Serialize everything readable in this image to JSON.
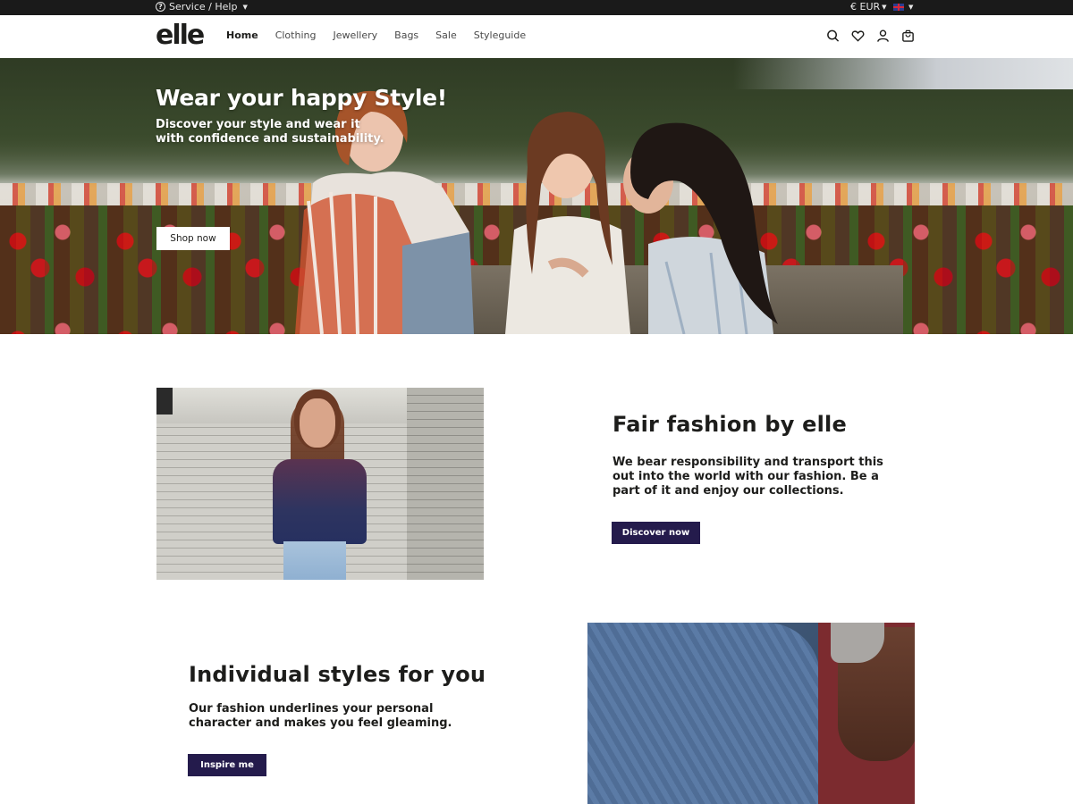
{
  "topbar": {
    "service_label": "Service / Help",
    "currency_label": "€ EUR"
  },
  "header": {
    "logo": "elle",
    "nav": [
      "Home",
      "Clothing",
      "Jewellery",
      "Bags",
      "Sale",
      "Styleguide"
    ],
    "active_nav": "Home",
    "icons": [
      "search-icon",
      "heart-icon",
      "user-icon",
      "bag-icon"
    ]
  },
  "hero": {
    "title": "Wear your happy Style!",
    "subtitle": "Discover your style and wear it with confidence and sustainability.",
    "button": "Shop now"
  },
  "section1": {
    "title": "Fair fashion by elle",
    "text": "We bear responsibility and transport this out into the world with our fashion. Be a part of it and enjoy our collections.",
    "button": "Discover now"
  },
  "section2": {
    "title": "Individual styles for you",
    "text": "Our fashion underlines your personal character and makes you feel gleaming.",
    "button": "Inspire me"
  },
  "colors": {
    "topbar_bg": "#1a1a1a",
    "button_dark": "#241b4c",
    "text": "#1d1d1b"
  }
}
